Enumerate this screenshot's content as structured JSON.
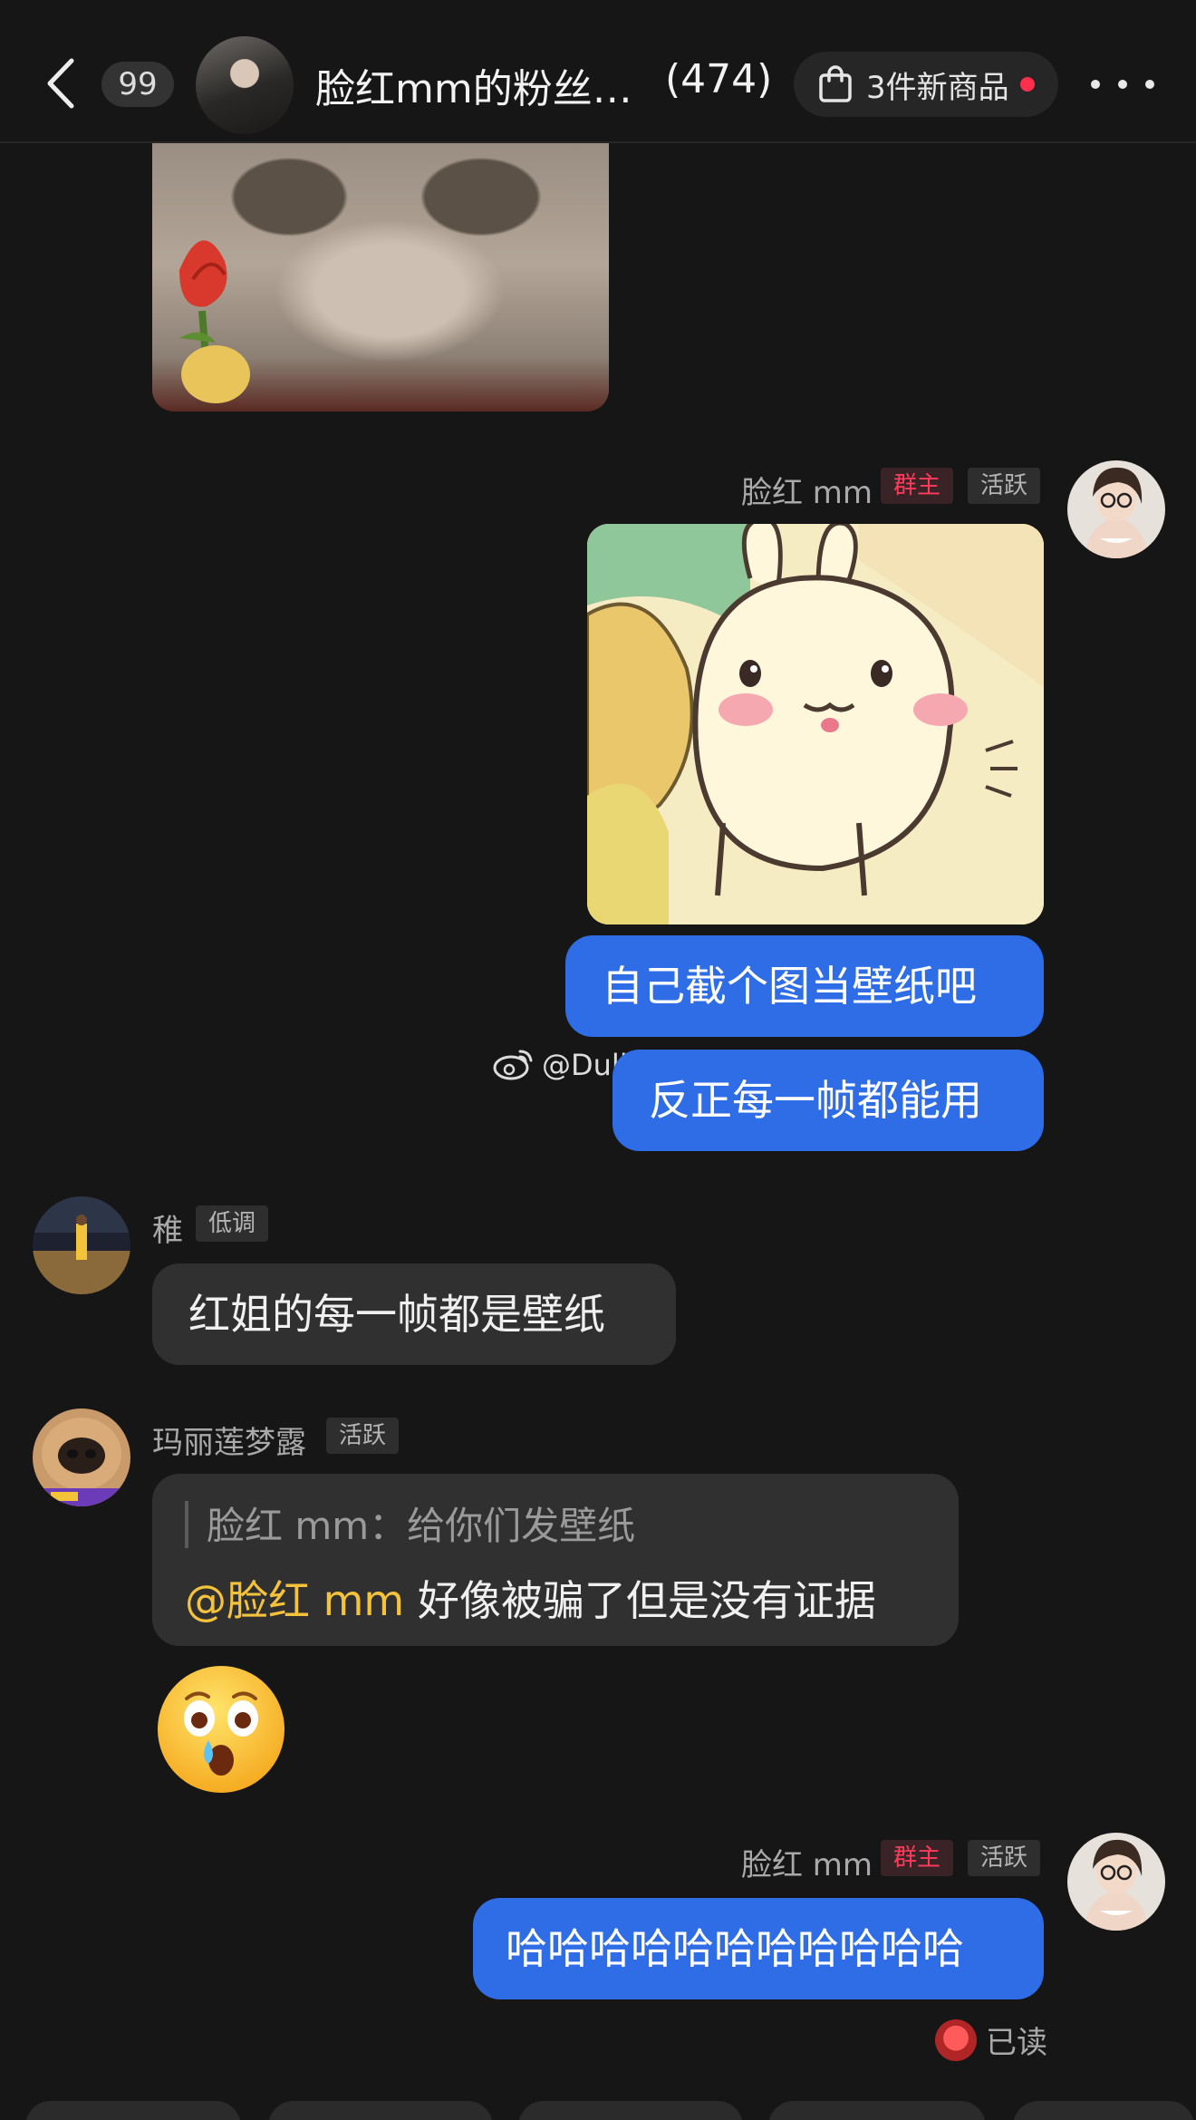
{
  "header": {
    "unread_count": "99",
    "group_title": "脸红mm的粉丝…",
    "member_count": "(474)",
    "shop_label": "3件新商品"
  },
  "watermark": "@Dull-迷人",
  "messages": {
    "m1_name": "脸红 mm",
    "m1_tag_owner": "群主",
    "m1_tag_status": "活跃",
    "m1_bubble1": "自己截个图当壁纸吧",
    "m1_bubble2": "反正每一帧都能用",
    "m2_name": "稚",
    "m2_tag": "低调",
    "m2_bubble": "红姐的每一帧都是壁纸",
    "m3_name": "玛丽莲梦露",
    "m3_tag": "活跃",
    "m3_quote": "脸红 mm：给你们发壁纸",
    "m3_mention": "@脸红 mm",
    "m3_reply": " 好像被骗了但是没有证据",
    "m4_name": "脸红 mm",
    "m4_tag_owner": "群主",
    "m4_tag_status": "活跃",
    "m4_bubble": "哈哈哈哈哈哈哈哈哈哈哈",
    "read_label": "已读"
  },
  "colors": {
    "background": "#161616",
    "bubble_blue": "#2f6de6",
    "bubble_gray": "#303030",
    "mention": "#f5c33b",
    "owner_tag": "#ff3b5c"
  },
  "icons": [
    "back-chevron-icon",
    "shopping-bag-icon",
    "more-dots-icon",
    "weibo-icon",
    "crying-surprised-emoji"
  ]
}
